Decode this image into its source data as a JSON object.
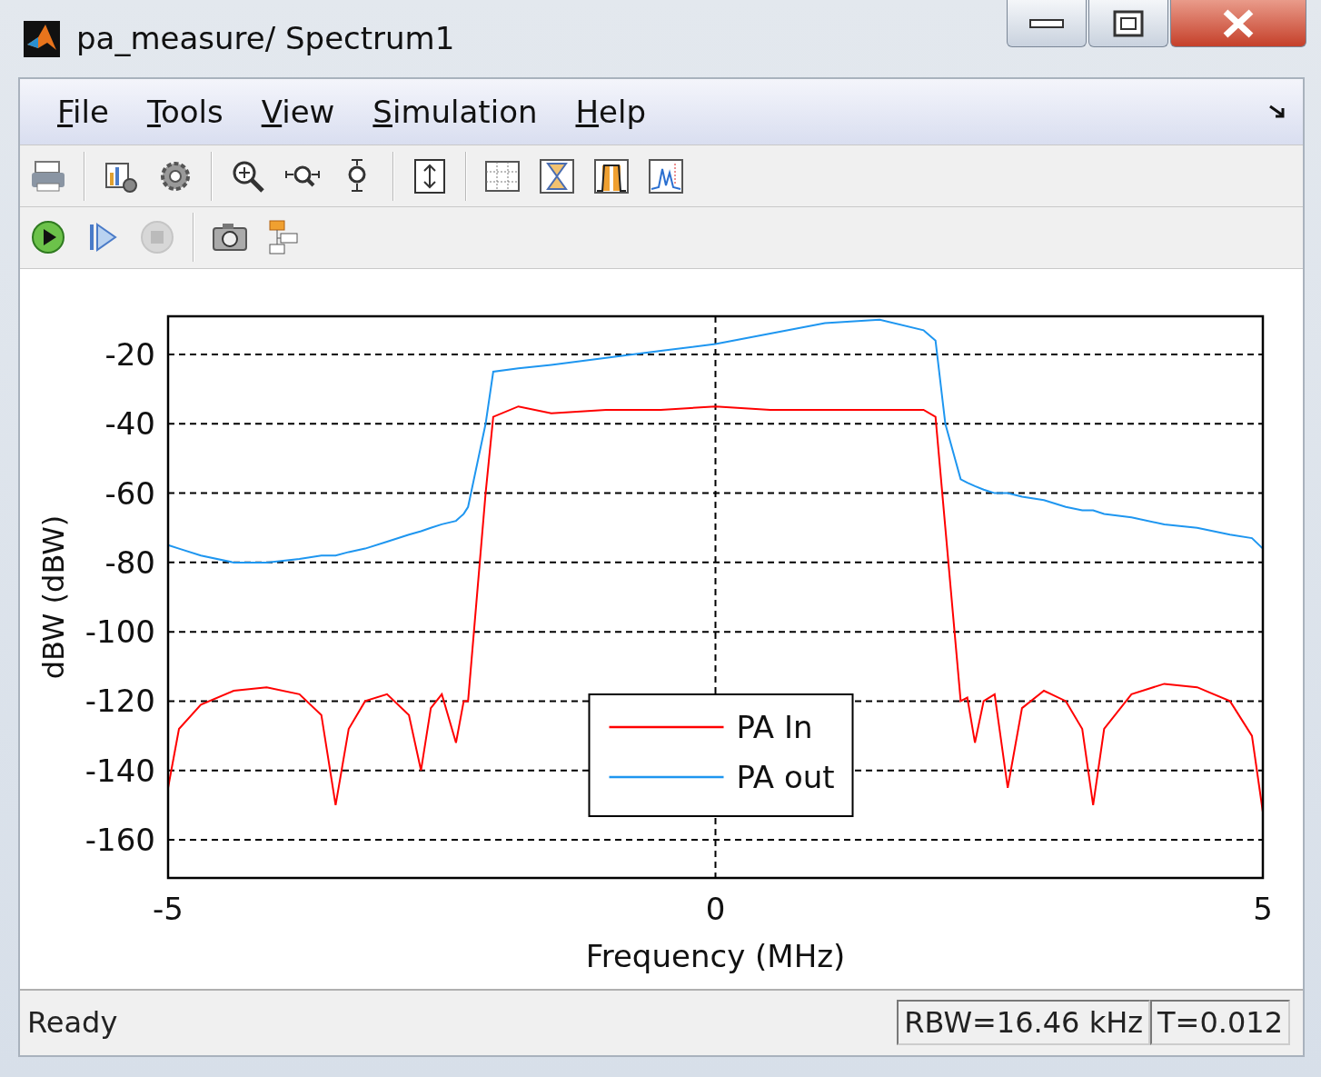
{
  "window": {
    "title": "pa_measure/ Spectrum1"
  },
  "menu": [
    {
      "label": "File"
    },
    {
      "label": "Tools"
    },
    {
      "label": "View"
    },
    {
      "label": "Simulation"
    },
    {
      "label": "Help"
    }
  ],
  "toolbar": [
    {
      "kind": "print",
      "disabled": false
    },
    {
      "kind": "sep"
    },
    {
      "kind": "properties",
      "disabled": false
    },
    {
      "kind": "settings",
      "disabled": false
    },
    {
      "kind": "sep"
    },
    {
      "kind": "zoom-in",
      "disabled": false
    },
    {
      "kind": "zoom-x",
      "disabled": false
    },
    {
      "kind": "zoom-y",
      "disabled": false
    },
    {
      "kind": "sep"
    },
    {
      "kind": "autoscale",
      "disabled": false
    },
    {
      "kind": "sep"
    },
    {
      "kind": "grid",
      "disabled": false
    },
    {
      "kind": "cursor",
      "disabled": false
    },
    {
      "kind": "peak",
      "disabled": false
    },
    {
      "kind": "measure",
      "disabled": false
    }
  ],
  "sim_toolbar": [
    {
      "kind": "run",
      "disabled": false
    },
    {
      "kind": "step",
      "disabled": false
    },
    {
      "kind": "stop",
      "disabled": true
    },
    {
      "kind": "sep"
    },
    {
      "kind": "snapshot",
      "disabled": false
    },
    {
      "kind": "highlight",
      "disabled": false
    }
  ],
  "chart_data": {
    "type": "line",
    "xlabel": "Frequency (MHz)",
    "ylabel": "dBW (dBW)",
    "xlim": [
      -5,
      5
    ],
    "ylim": [
      -171,
      -9
    ],
    "xticks": [
      -5,
      0,
      5
    ],
    "grid": true,
    "legend": true,
    "yticks": [
      -20,
      -40,
      -60,
      -80,
      -100,
      -120,
      -140,
      -160
    ],
    "x": [
      -5,
      -4.9,
      -4.7,
      -4.4,
      -4.1,
      -3.8,
      -3.6,
      -3.47,
      -3.35,
      -3.2,
      -3.0,
      -2.8,
      -2.69,
      -2.6,
      -2.5,
      -2.37,
      -2.3,
      -2.26,
      -2.1,
      -2.03,
      -1.8,
      -1.5,
      -1.0,
      -0.5,
      0,
      0.5,
      1.0,
      1.5,
      1.9,
      2.01,
      2.1,
      2.24,
      2.3,
      2.37,
      2.45,
      2.55,
      2.67,
      2.8,
      3.0,
      3.2,
      3.35,
      3.45,
      3.55,
      3.8,
      4.1,
      4.4,
      4.7,
      4.9,
      5
    ],
    "series": [
      {
        "name": "PA In",
        "color": "#ff0000",
        "values": [
          -145,
          -128,
          -121,
          -117,
          -116,
          -118,
          -124,
          -150,
          -128,
          -120,
          -118,
          -124,
          -140,
          -122,
          -118,
          -132,
          -120,
          -120,
          -60,
          -38,
          -35,
          -37,
          -36,
          -36,
          -35,
          -36,
          -36,
          -36,
          -36,
          -38,
          -70,
          -120,
          -119,
          -132,
          -120,
          -118,
          -145,
          -122,
          -117,
          -120,
          -128,
          -150,
          -128,
          -118,
          -115,
          -116,
          -120,
          -130,
          -152
        ]
      },
      {
        "name": "PA out",
        "color": "#1e96f0",
        "values": [
          -75,
          -76,
          -78,
          -80,
          -80,
          -79,
          -78,
          -78,
          -77,
          -76,
          -74,
          -72,
          -71,
          -70,
          -69,
          -68,
          -66,
          -64,
          -40,
          -25,
          -24,
          -23,
          -21,
          -19,
          -17,
          -14,
          -11,
          -10,
          -13,
          -16,
          -40,
          -56,
          -57,
          -58,
          -59,
          -60,
          -60,
          -61,
          -62,
          -64,
          -65,
          -65,
          -66,
          -67,
          -69,
          -70,
          -72,
          -73,
          -76
        ]
      }
    ]
  },
  "status_bar": {
    "text": "Ready",
    "fields": [
      "RBW=16.46 kHz",
      "T=0.012"
    ]
  }
}
